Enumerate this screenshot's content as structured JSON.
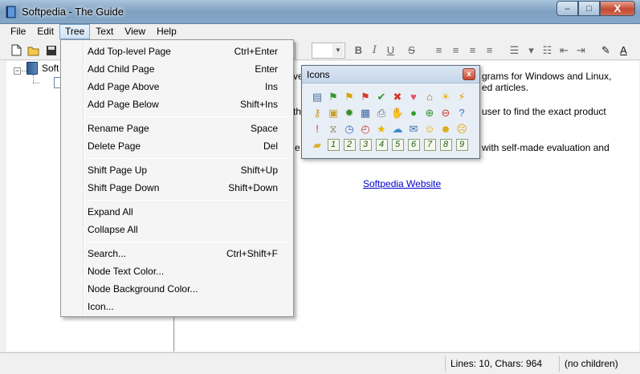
{
  "window": {
    "title": "Softpedia - The Guide"
  },
  "caption": {
    "minimize": "–",
    "maximize": "□",
    "close": "X"
  },
  "menubar": {
    "items": [
      "File",
      "Edit",
      "Tree",
      "Text",
      "View",
      "Help"
    ],
    "active": "Tree"
  },
  "tree": {
    "root_label": "Soft",
    "expander": "−"
  },
  "editor": {
    "lines": [
      "grams for Windows and Linux,",
      "ed articles.",
      "user to find the exact product",
      "with self-made evaluation and"
    ],
    "left_fragments": [
      "ve",
      "th",
      "e"
    ],
    "link": "Softpedia Website"
  },
  "statusbar": {
    "lines_chars": "Lines: 10, Chars: 964",
    "node_info": "(no children)"
  },
  "tree_menu": {
    "groups": [
      [
        {
          "label": "Add Top-level Page",
          "shortcut": "Ctrl+Enter"
        },
        {
          "label": "Add Child Page",
          "shortcut": "Enter"
        },
        {
          "label": "Add Page Above",
          "shortcut": "Ins"
        },
        {
          "label": "Add Page Below",
          "shortcut": "Shift+Ins"
        }
      ],
      [
        {
          "label": "Rename Page",
          "shortcut": "Space"
        },
        {
          "label": "Delete Page",
          "shortcut": "Del"
        }
      ],
      [
        {
          "label": "Shift Page Up",
          "shortcut": "Shift+Up"
        },
        {
          "label": "Shift Page Down",
          "shortcut": "Shift+Down"
        }
      ],
      [
        {
          "label": "Expand All",
          "shortcut": ""
        },
        {
          "label": "Collapse All",
          "shortcut": ""
        }
      ],
      [
        {
          "label": "Search...",
          "shortcut": "Ctrl+Shift+F"
        },
        {
          "label": "Node Text Color...",
          "shortcut": ""
        },
        {
          "label": "Node Background Color...",
          "shortcut": ""
        },
        {
          "label": "Icon...",
          "shortcut": ""
        }
      ]
    ]
  },
  "icons_palette": {
    "title": "Icons",
    "close": "x",
    "icons": [
      {
        "name": "note-icon",
        "glyph": "▤",
        "color": "#4a6fa5"
      },
      {
        "name": "green-flag-icon",
        "glyph": "⚑",
        "color": "#2e9a2e"
      },
      {
        "name": "yellow-flag-icon",
        "glyph": "⚑",
        "color": "#d9a400"
      },
      {
        "name": "red-flag-icon",
        "glyph": "⚑",
        "color": "#d23a2a"
      },
      {
        "name": "checkmark-icon",
        "glyph": "✔",
        "color": "#2e9a2e"
      },
      {
        "name": "cross-icon",
        "glyph": "✖",
        "color": "#d23a2a"
      },
      {
        "name": "heart-icon",
        "glyph": "♥",
        "color": "#e0506a"
      },
      {
        "name": "home-icon",
        "glyph": "⌂",
        "color": "#b06a2a"
      },
      {
        "name": "lightbulb-icon",
        "glyph": "☀",
        "color": "#e8b800"
      },
      {
        "name": "lightning-icon",
        "glyph": "⚡",
        "color": "#e8a000"
      },
      {
        "name": "key-icon",
        "glyph": "⚷",
        "color": "#c99a20"
      },
      {
        "name": "lock-icon",
        "glyph": "▣",
        "color": "#c9a030"
      },
      {
        "name": "bug-icon",
        "glyph": "✹",
        "color": "#3a8a2a"
      },
      {
        "name": "calendar-icon",
        "glyph": "▦",
        "color": "#3a6aa8"
      },
      {
        "name": "printer-icon",
        "glyph": "⎙",
        "color": "#5a6a7a"
      },
      {
        "name": "thumbs-up-icon",
        "glyph": "✋",
        "color": "#e0a890"
      },
      {
        "name": "ok-circle-icon",
        "glyph": "●",
        "color": "#2e9a2e"
      },
      {
        "name": "plus-circle-icon",
        "glyph": "⊕",
        "color": "#2e9a2e"
      },
      {
        "name": "minus-circle-icon",
        "glyph": "⊖",
        "color": "#d23a2a"
      },
      {
        "name": "help-circle-icon",
        "glyph": "?",
        "color": "#3a6ad0"
      },
      {
        "name": "warning-icon",
        "glyph": "!",
        "color": "#d23a2a"
      },
      {
        "name": "hourglass-icon",
        "glyph": "⧖",
        "color": "#8a7a5a"
      },
      {
        "name": "clock-icon",
        "glyph": "◷",
        "color": "#3a6ad0"
      },
      {
        "name": "alarm-clock-icon",
        "glyph": "◴",
        "color": "#d23a2a"
      },
      {
        "name": "star-icon",
        "glyph": "★",
        "color": "#e8b800"
      },
      {
        "name": "speech-bubble-icon",
        "glyph": "☁",
        "color": "#3a8ad0"
      },
      {
        "name": "envelope-icon",
        "glyph": "✉",
        "color": "#3a6aa8"
      },
      {
        "name": "smiley-icon",
        "glyph": "☺",
        "color": "#e0a800"
      },
      {
        "name": "neutral-face-icon",
        "glyph": "☻",
        "color": "#e0a800"
      },
      {
        "name": "sad-face-icon",
        "glyph": "☹",
        "color": "#e0a800"
      },
      {
        "name": "folder-icon",
        "glyph": "▰",
        "color": "#e0b030"
      },
      {
        "name": "number-1-icon",
        "glyph": "1",
        "color": "#2a5a1a"
      },
      {
        "name": "number-2-icon",
        "glyph": "2",
        "color": "#2a5a1a"
      },
      {
        "name": "number-3-icon",
        "glyph": "3",
        "color": "#2a5a1a"
      },
      {
        "name": "number-4-icon",
        "glyph": "4",
        "color": "#2a5a1a"
      },
      {
        "name": "number-5-icon",
        "glyph": "5",
        "color": "#2a5a1a"
      },
      {
        "name": "number-6-icon",
        "glyph": "6",
        "color": "#2a5a1a"
      },
      {
        "name": "number-7-icon",
        "glyph": "7",
        "color": "#2a5a1a"
      },
      {
        "name": "number-8-icon",
        "glyph": "8",
        "color": "#2a5a1a"
      },
      {
        "name": "number-9-icon",
        "glyph": "9",
        "color": "#2a5a1a"
      }
    ]
  },
  "colors": {
    "selection": "#3399ff",
    "link": "#0000cc",
    "titlebar": "#86a8c8"
  }
}
